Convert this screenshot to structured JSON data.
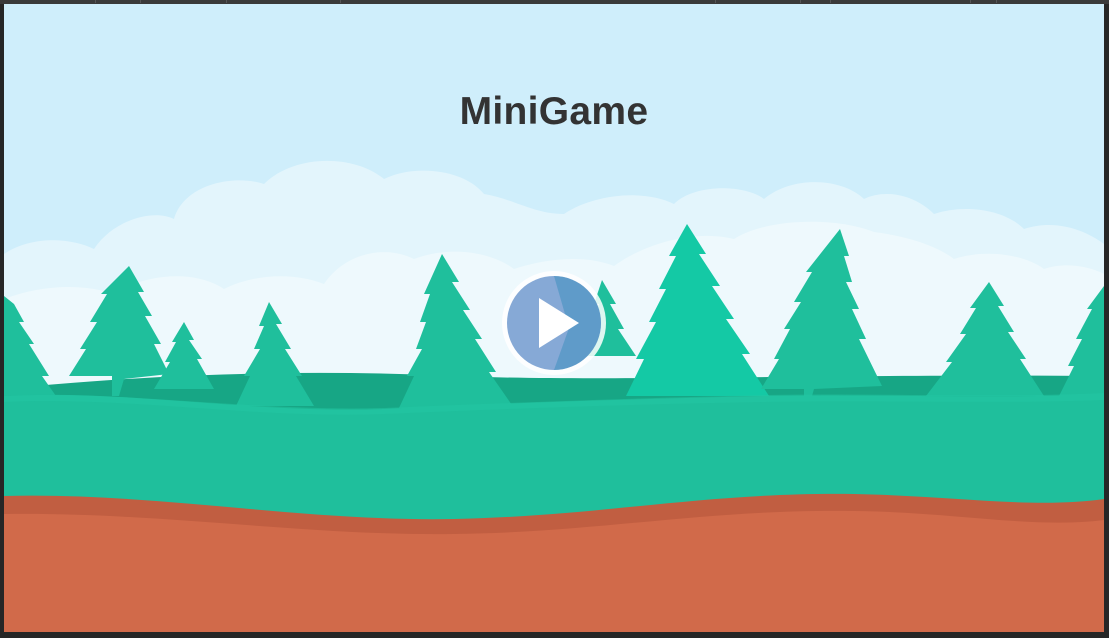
{
  "game": {
    "title": "MiniGame"
  },
  "controls": {
    "play_icon": "play-icon"
  },
  "colors": {
    "sky": "#cfeefb",
    "clouds": "#e3f5fc",
    "trees": "#1fbf9c",
    "trees_dark": "#17a685",
    "grass": "#1fbf9c",
    "dirt": "#d16a4a",
    "dirt_edge": "#c15e41",
    "title": "#333333",
    "play_button": "#86a9d6"
  }
}
